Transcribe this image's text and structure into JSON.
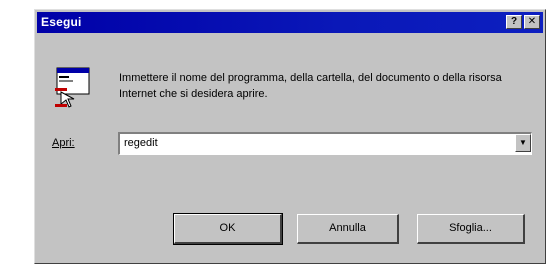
{
  "window": {
    "title": "Esegui",
    "help_glyph": "?",
    "close_glyph": "✕"
  },
  "icons": {
    "dialog_icon": "run-program-icon",
    "dropdown": "triangle-down-icon"
  },
  "prompt": {
    "text": "Immettere il nome del programma, della cartella, del documento o della risorsa Internet che si desidera aprire."
  },
  "open_field": {
    "label": "Apri:",
    "value": "regedit",
    "arrow_glyph": "▼"
  },
  "buttons": {
    "ok": "OK",
    "cancel": "Annulla",
    "browse": "Sfoglia..."
  },
  "colors": {
    "titlebar": "#0000a8",
    "face": "#c3c3c3"
  }
}
